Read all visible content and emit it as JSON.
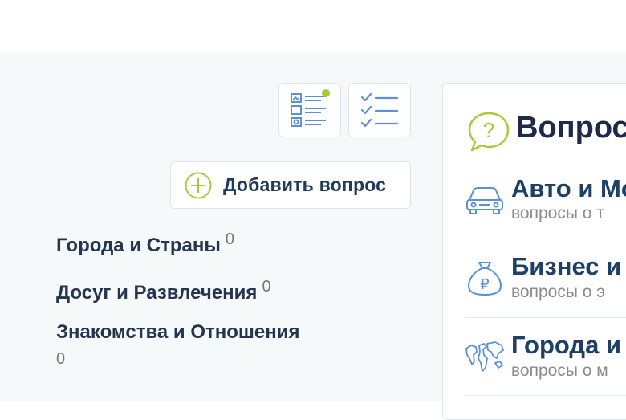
{
  "toolbar": {
    "add_question_label": "Добавить вопрос",
    "accent_color": "#a3cc3c",
    "icon_color": "#5b8fd8"
  },
  "categories": [
    {
      "label": "Города и Страны",
      "count": "0"
    },
    {
      "label": "Досуг и Развлечения",
      "count": "0"
    },
    {
      "label": "Знакомства и Отношения",
      "count": "0"
    }
  ],
  "panel": {
    "title": "Вопрос",
    "rows": [
      {
        "title": "Авто и Мо",
        "subtitle": "вопросы о т",
        "icon": "car-icon"
      },
      {
        "title": "Бизнес и",
        "subtitle": "вопросы о э",
        "icon": "money-bag-icon"
      },
      {
        "title": "Города и",
        "subtitle": "вопросы о м",
        "icon": "world-map-icon"
      }
    ]
  }
}
